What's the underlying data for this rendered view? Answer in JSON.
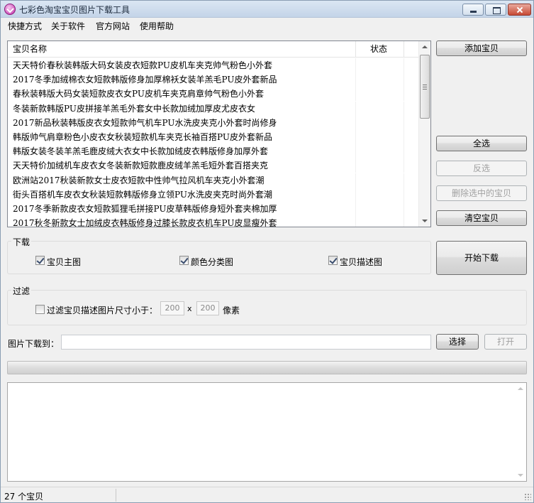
{
  "window": {
    "title": "七彩色淘宝宝贝图片下载工具"
  },
  "menu": [
    {
      "label": "快捷方式"
    },
    {
      "label": "关于软件"
    },
    {
      "label": "官方网站"
    },
    {
      "label": "使用帮助"
    }
  ],
  "list": {
    "columns": [
      "宝贝名称",
      "状态"
    ],
    "items": [
      "天天特价春秋装韩版大码女装皮衣短款PU皮机车夹克帅气粉色小外套",
      "2017冬季加绒棉衣女短款韩版修身加厚棉袄女装羊羔毛PU皮外套新品",
      "春秋装韩版大码女装短款皮衣女PU皮机车夹克肩章帅气粉色小外套",
      "冬装新款韩版PU皮拼接羊羔毛外套女中长款加绒加厚皮尤皮衣女",
      "2017新品秋装韩版皮衣女短款帅气机车PU水洗皮夹克小外套时尚修身",
      "韩版帅气肩章粉色小皮衣女秋装短款机车夹克长袖百搭PU皮外套新品",
      "韩版女装冬装羊羔毛鹿皮绒大衣女中长款加绒皮衣韩版修身加厚外套",
      "天天特价加绒机车皮衣女冬装新款短款鹿皮绒羊羔毛短外套百搭夹克",
      "欧洲站2017秋装新款女士皮衣短款中性帅气拉风机车夹克小外套潮",
      "街头百搭机车皮衣女秋装短款韩版修身立领PU水洗皮夹克时尚外套潮",
      "2017冬季新款皮衣女短款狐狸毛拼接PU皮草韩版修身短外套夹棉加厚",
      "2017秋冬新款女士加绒皮衣韩版修身过膝长款皮衣机车PU皮显瘦外套"
    ]
  },
  "buttons": {
    "add": "添加宝贝",
    "select_all": "全选",
    "invert": "反选",
    "delete_selected": "删除选中的宝贝",
    "clear": "清空宝贝",
    "start": "开始下载",
    "choose": "选择",
    "open": "打开"
  },
  "download_group": {
    "title": "下载",
    "options": [
      {
        "label": "宝贝主图",
        "checked": true
      },
      {
        "label": "颜色分类图",
        "checked": true
      },
      {
        "label": "宝贝描述图",
        "checked": true
      }
    ]
  },
  "filter_group": {
    "title": "过滤",
    "checkbox_label": "过滤宝贝描述图片尺寸小于：",
    "checked": false,
    "width": "200",
    "times": "x",
    "height": "200",
    "unit": "像素"
  },
  "path": {
    "label": "图片下载到：",
    "value": ""
  },
  "progress": {
    "value": 0
  },
  "status": {
    "count_text": "27 个宝贝"
  }
}
